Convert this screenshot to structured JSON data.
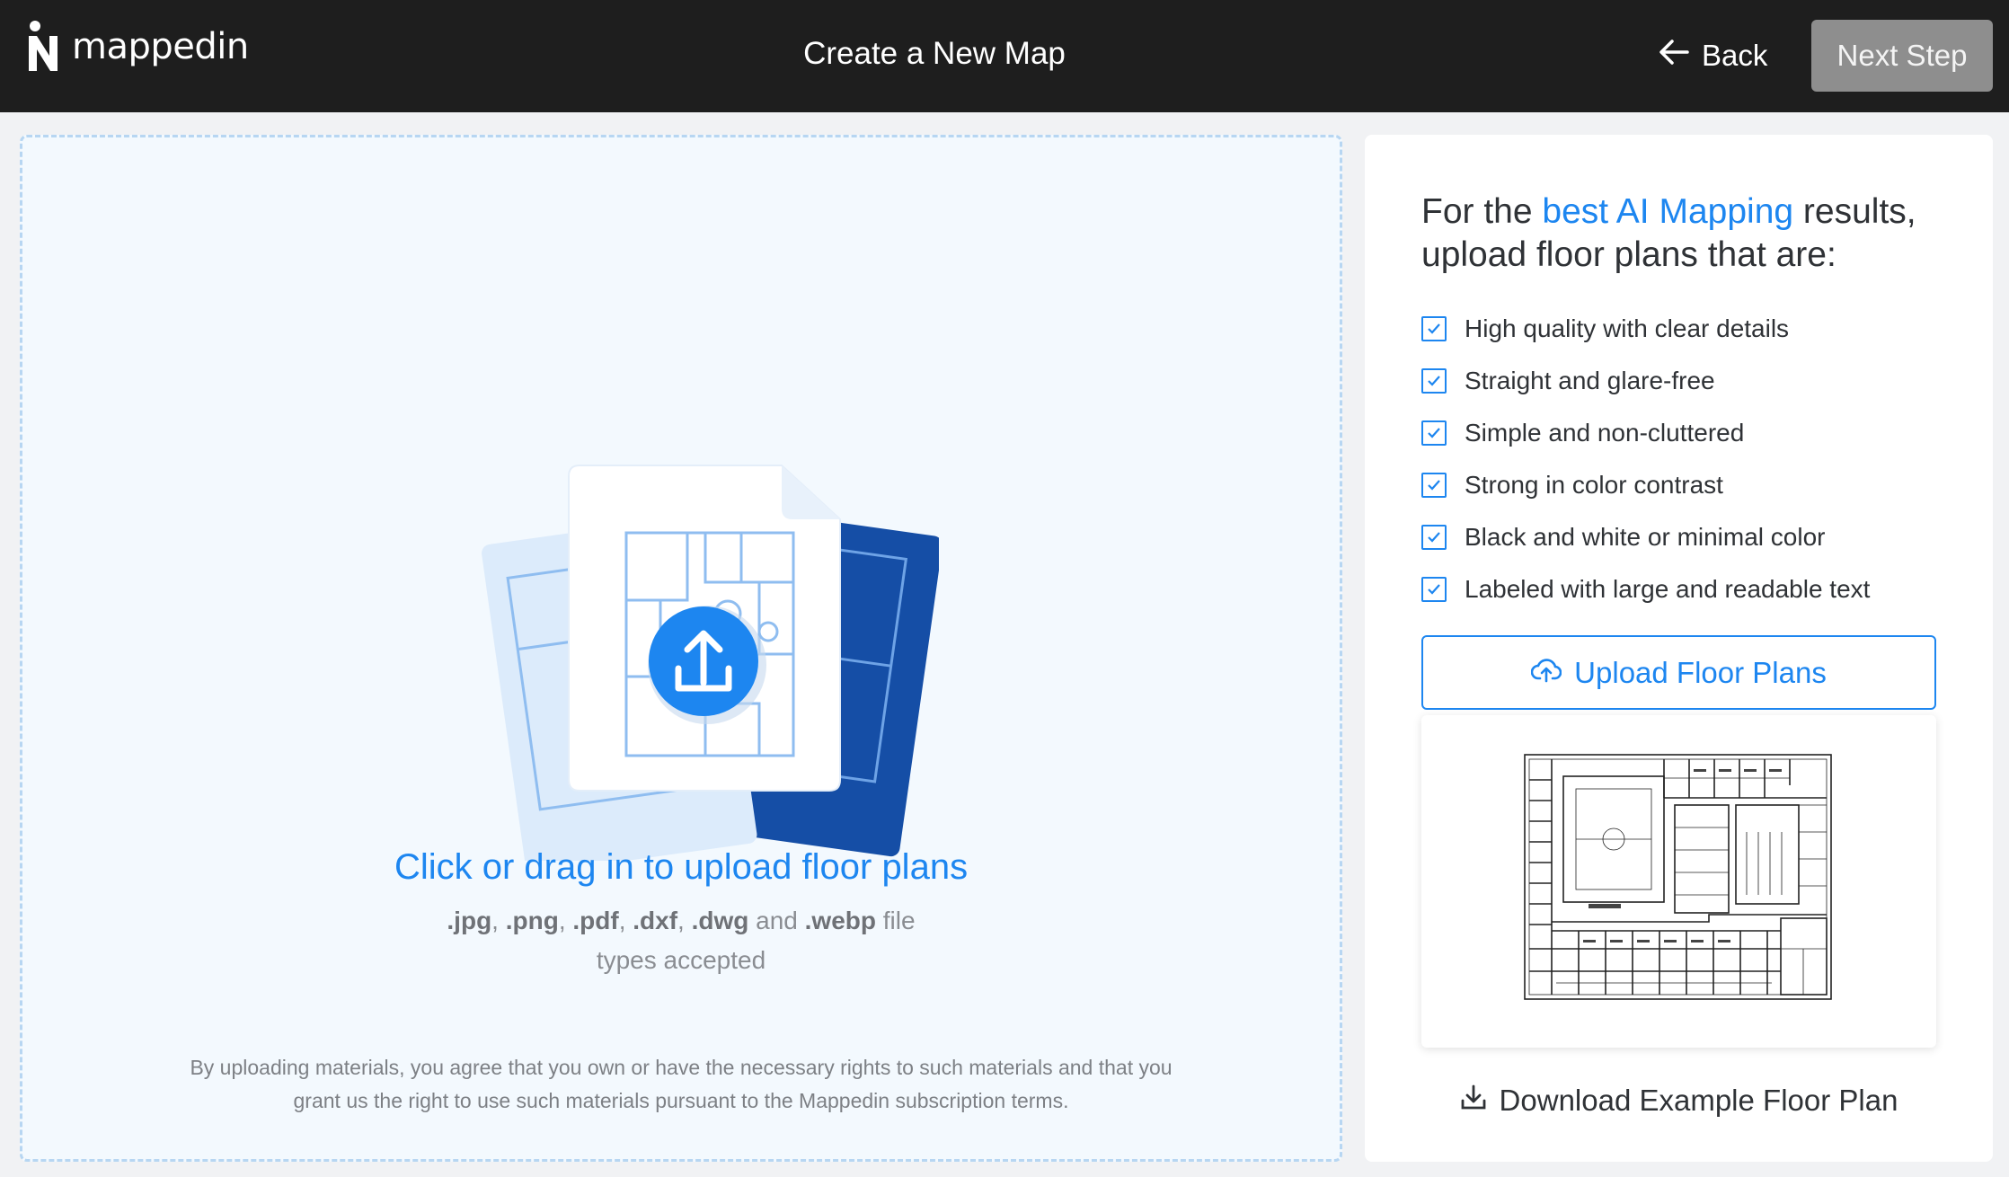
{
  "header": {
    "logo_text": "mappedin",
    "title": "Create a New Map",
    "back_label": "Back",
    "next_label": "Next Step"
  },
  "dropzone": {
    "cta": "Click or drag in to upload floor plans",
    "filetypes": {
      "t1": ".jpg",
      "s1": ", ",
      "t2": ".png",
      "s2": ", ",
      "t3": ".pdf",
      "s3": ", ",
      "t4": ".dxf",
      "s4": ", ",
      "t5": ".dwg",
      "s5": " and ",
      "t6": ".webp",
      "suffix": " file types accepted"
    },
    "legal": "By uploading materials, you agree that you own or have the necessary rights to such materials and that you grant us the right to use such materials pursuant to the Mappedin subscription terms."
  },
  "panel": {
    "heading_prefix": "For the ",
    "heading_accent": "best AI Mapping",
    "heading_suffix": " results, upload floor plans that are:",
    "checklist": [
      "High quality with clear details",
      "Straight and glare-free",
      "Simple and non-cluttered",
      "Strong in color contrast",
      "Black and white or minimal color",
      "Labeled with large and readable text"
    ],
    "upload_label": "Upload Floor Plans",
    "download_label": "Download Example Floor Plan"
  },
  "colors": {
    "header_bg": "#1e1e1e",
    "accent": "#1d86f0",
    "next_button_bg": "#8e8e8e",
    "dropzone_bg": "#f3f9fe"
  },
  "icons": {
    "logo": "mappedin-logo-icon",
    "back": "arrow-left-icon",
    "upload": "upload-icon",
    "cloud_upload": "cloud-upload-icon",
    "download": "download-icon",
    "check": "checkbox-checked-icon"
  }
}
